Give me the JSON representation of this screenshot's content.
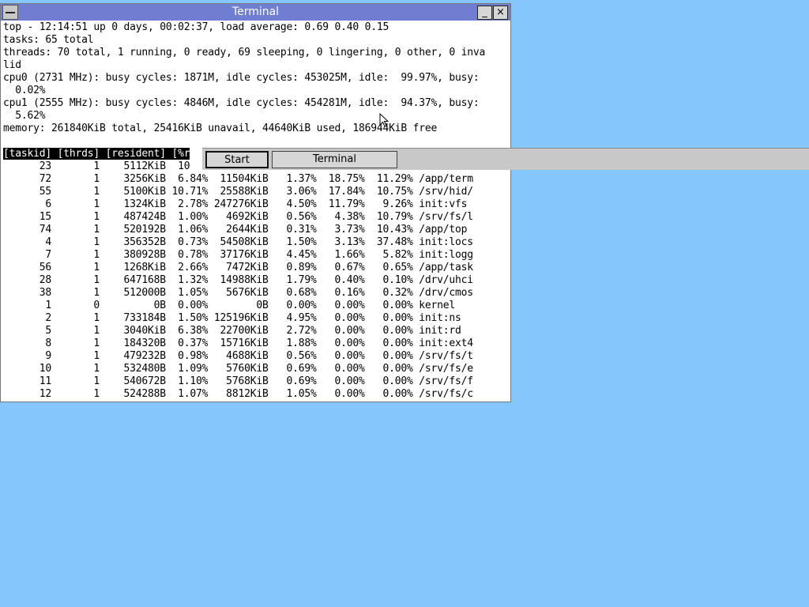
{
  "window": {
    "title": "Terminal",
    "minimize_label": "_",
    "close_label": "×",
    "sysmenu_icon": "system-menu-icon"
  },
  "terminal": {
    "lines": [
      "top - 12:14:51 up 0 days, 00:02:37, load average: 0.69 0.40 0.15",
      "tasks: 65 total",
      "threads: 70 total, 1 running, 0 ready, 69 sleeping, 0 lingering, 0 other, 0 inva",
      "lid",
      "cpu0 (2731 MHz): busy cycles: 1871M, idle cycles: 453025M, idle:  99.97%, busy:",
      "  0.02%",
      "cpu1 (2555 MHz): busy cycles: 4846M, idle cycles: 454281M, idle:  94.37%, busy:",
      "  5.62%",
      "memory: 261840KiB total, 25416KiB unavail, 44640KiB used, 186944KiB free",
      ""
    ],
    "table_header": "[taskid] [thrds] [resident] [%r",
    "rows": [
      "      23       1    5112KiB  10",
      "      72       1    3256KiB  6.84%  11504KiB   1.37%  18.75%  11.29% /app/term",
      "      55       1    5100KiB 10.71%  25588KiB   3.06%  17.84%  10.75% /srv/hid/",
      "       6       1    1324KiB  2.78% 247276KiB   4.50%  11.79%   9.26% init:vfs",
      "      15       1    487424B  1.00%   4692KiB   0.56%   4.38%  10.79% /srv/fs/l",
      "      74       1    520192B  1.06%   2644KiB   0.31%   3.73%  10.43% /app/top",
      "       4       1    356352B  0.73%  54508KiB   1.50%   3.13%  37.48% init:locs",
      "       7       1    380928B  0.78%  37176KiB   4.45%   1.66%   5.82% init:logg",
      "      56       1    1268KiB  2.66%   7472KiB   0.89%   0.67%   0.65% /app/task",
      "      28       1    647168B  1.32%  14988KiB   1.79%   0.40%   0.10% /drv/uhci",
      "      38       1    512000B  1.05%   5676KiB   0.68%   0.16%   0.32% /drv/cmos",
      "       1       0         0B  0.00%        0B   0.00%   0.00%   0.00% kernel",
      "       2       1    733184B  1.50% 125196KiB   4.95%   0.00%   0.00% init:ns",
      "       5       1    3040KiB  6.38%  22700KiB   2.72%   0.00%   0.00% init:rd",
      "       8       1    184320B  0.37%  15716KiB   1.88%   0.00%   0.00% init:ext4",
      "       9       1    479232B  0.98%   4688KiB   0.56%   0.00%   0.00% /srv/fs/t",
      "      10       1    532480B  1.09%   5760KiB   0.69%   0.00%   0.00% /srv/fs/e",
      "      11       1    540672B  1.10%   5768KiB   0.69%   0.00%   0.00% /srv/fs/f",
      "      12       1    524288B  1.07%   8812KiB   1.05%   0.00%   0.00% /srv/fs/c"
    ]
  },
  "taskbar": {
    "start_label": "Start",
    "items": [
      {
        "label": "Terminal"
      }
    ]
  },
  "colors": {
    "desktop": "#85c7fd",
    "titlebar": "#6f7ed0",
    "taskbar": "#c8c8c8"
  }
}
